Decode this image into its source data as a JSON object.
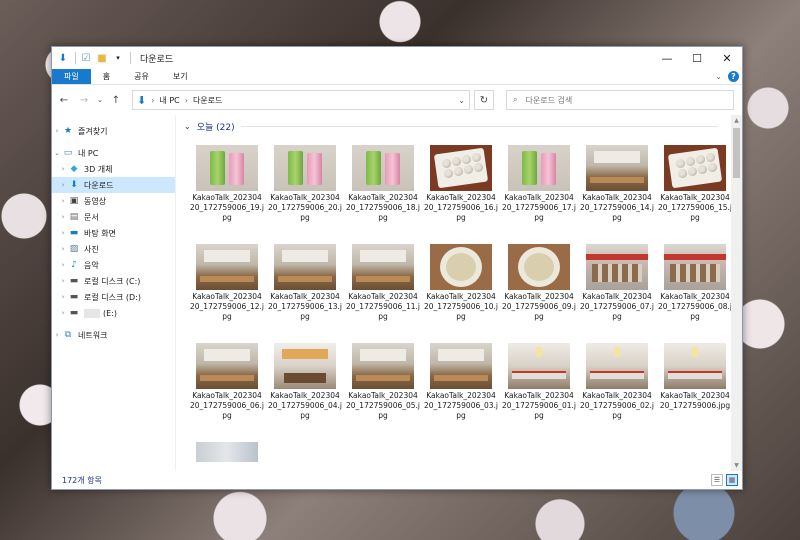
{
  "window": {
    "title": "다운로드"
  },
  "ribbon": {
    "tabs": [
      "파일",
      "홈",
      "공유",
      "보기"
    ]
  },
  "address": {
    "crumbs": [
      "내 PC",
      "다운로드"
    ]
  },
  "search": {
    "placeholder": "다운로드 검색"
  },
  "nav": {
    "quick_access": "즐겨찾기",
    "this_pc": "내 PC",
    "items": [
      "3D 개체",
      "다운로드",
      "동영상",
      "문서",
      "바탕 화면",
      "사진",
      "음악",
      "로컬 디스크 (C:)",
      "로컬 디스크 (D:)",
      "(E:)"
    ],
    "network": "네트워크"
  },
  "group": {
    "header": "오늘 (22)"
  },
  "files": [
    {
      "name": "KakaoTalk_20230420_172759006_19.jpg",
      "thumb": "drinks"
    },
    {
      "name": "KakaoTalk_20230420_172759006_20.jpg",
      "thumb": "drinks"
    },
    {
      "name": "KakaoTalk_20230420_172759006_18.jpg",
      "thumb": "drinks"
    },
    {
      "name": "KakaoTalk_20230420_172759006_16.jpg",
      "thumb": "dumpling"
    },
    {
      "name": "KakaoTalk_20230420_172759006_17.jpg",
      "thumb": "drinks"
    },
    {
      "name": "KakaoTalk_20230420_172759006_14.jpg",
      "thumb": "restaurant"
    },
    {
      "name": "KakaoTalk_20230420_172759006_15.jpg",
      "thumb": "dumpling"
    },
    {
      "name": "KakaoTalk_20230420_172759006_12.jpg",
      "thumb": "restaurant"
    },
    {
      "name": "KakaoTalk_20230420_172759006_13.jpg",
      "thumb": "restaurant"
    },
    {
      "name": "KakaoTalk_20230420_172759006_11.jpg",
      "thumb": "restaurant"
    },
    {
      "name": "KakaoTalk_20230420_172759006_10.jpg",
      "thumb": "soup"
    },
    {
      "name": "KakaoTalk_20230420_172759006_09.jpg",
      "thumb": "soup"
    },
    {
      "name": "KakaoTalk_20230420_172759006_07.jpg",
      "thumb": "store"
    },
    {
      "name": "KakaoTalk_20230420_172759006_08.jpg",
      "thumb": "store"
    },
    {
      "name": "KakaoTalk_20230420_172759006_06.jpg",
      "thumb": "restaurant"
    },
    {
      "name": "KakaoTalk_20230420_172759006_04.jpg",
      "thumb": "interior"
    },
    {
      "name": "KakaoTalk_20230420_172759006_05.jpg",
      "thumb": "restaurant"
    },
    {
      "name": "KakaoTalk_20230420_172759006_03.jpg",
      "thumb": "restaurant"
    },
    {
      "name": "KakaoTalk_20230420_172759006_01.jpg",
      "thumb": "kitchen"
    },
    {
      "name": "KakaoTalk_20230420_172759006_02.jpg",
      "thumb": "kitchen"
    },
    {
      "name": "KakaoTalk_20230420_172759006.jpg",
      "thumb": "kitchen"
    }
  ],
  "status": {
    "count": "172개 항목"
  },
  "colors": {
    "accent": "#1979ca",
    "selection": "#cce8ff",
    "group_header": "#1e3287"
  }
}
